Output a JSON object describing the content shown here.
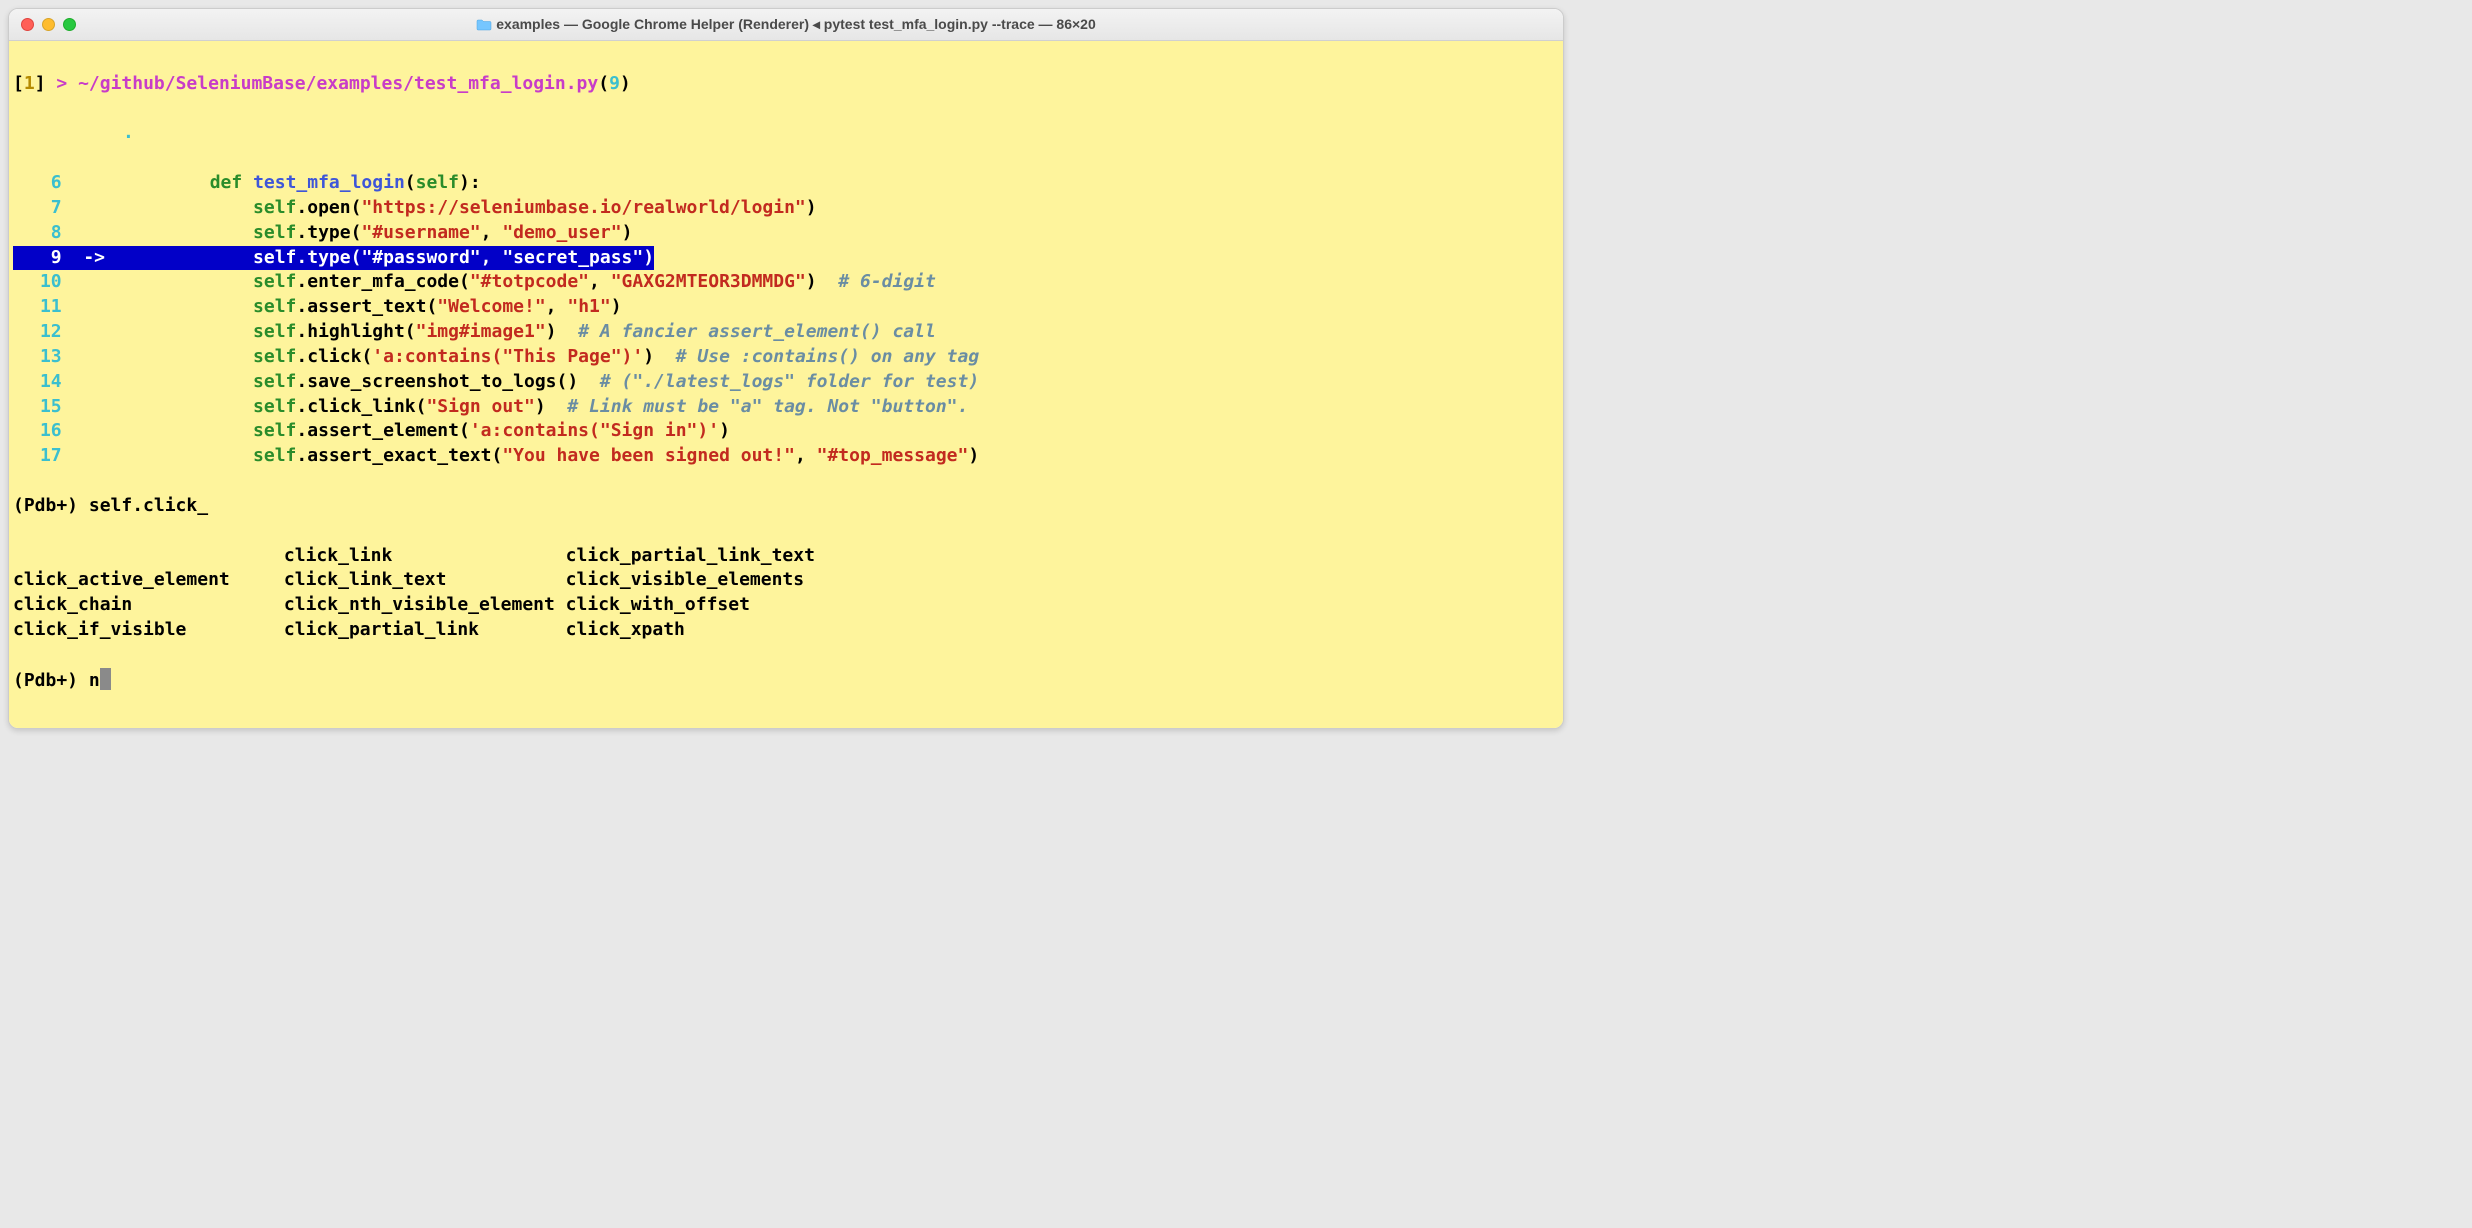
{
  "window": {
    "title": "examples — Google Chrome Helper (Renderer) ◂ pytest test_mfa_login.py --trace — 86×20"
  },
  "header": {
    "bracket_open": "[",
    "num": "1",
    "bracket_close": "] ",
    "gt": ">",
    "sp": " ",
    "path": "~/github/SeleniumBase/examples/test_mfa_login.py",
    "paren_open": "(",
    "cur_line": "9",
    "paren_close": ")"
  },
  "ellipsis": ".",
  "lines": [
    {
      "n": "6",
      "indent": "        ",
      "pre": "def ",
      "fn": "test_mfa_login",
      "sig_open": "(",
      "self": "self",
      "sig_close": "):",
      "arrow": "",
      "hl": false
    },
    {
      "n": "7",
      "indent": "            ",
      "self": "self",
      "dot": ".",
      "method": "open",
      "args_open": "(",
      "str": "\"https://seleniumbase.io/realworld/login\"",
      "args_close": ")",
      "arrow": "",
      "hl": false
    },
    {
      "n": "8",
      "indent": "            ",
      "self": "self",
      "dot": ".",
      "method": "type",
      "args_open": "(",
      "str": "\"#username\"",
      "sep": ", ",
      "str2": "\"demo_user\"",
      "args_close": ")",
      "arrow": "",
      "hl": false
    },
    {
      "n": "9",
      "indent": "            ",
      "self": "self",
      "dot": ".",
      "method": "type",
      "args_open": "(",
      "str": "\"#password\"",
      "sep": ", ",
      "str2": "\"secret_pass\"",
      "args_close": ")",
      "arrow": "->",
      "hl": true
    },
    {
      "n": "10",
      "indent": "            ",
      "self": "self",
      "dot": ".",
      "method": "enter_mfa_code",
      "args_open": "(",
      "str": "\"#totpcode\"",
      "sep": ", ",
      "str2": "\"GAXG2MTEOR3DMMDG\"",
      "args_close": ")",
      "cmt": "  # 6-digit",
      "arrow": "",
      "hl": false
    },
    {
      "n": "11",
      "indent": "            ",
      "self": "self",
      "dot": ".",
      "method": "assert_text",
      "args_open": "(",
      "str": "\"Welcome!\"",
      "sep": ", ",
      "str2": "\"h1\"",
      "args_close": ")",
      "arrow": "",
      "hl": false
    },
    {
      "n": "12",
      "indent": "            ",
      "self": "self",
      "dot": ".",
      "method": "highlight",
      "args_open": "(",
      "str": "\"img#image1\"",
      "args_close": ")",
      "cmt": "  # A fancier assert_element() call",
      "arrow": "",
      "hl": false
    },
    {
      "n": "13",
      "indent": "            ",
      "self": "self",
      "dot": ".",
      "method": "click",
      "args_open": "(",
      "str": "'a:contains(\"This Page\")'",
      "args_close": ")",
      "cmt": "  # Use :contains() on any tag",
      "arrow": "",
      "hl": false
    },
    {
      "n": "14",
      "indent": "            ",
      "self": "self",
      "dot": ".",
      "method": "save_screenshot_to_logs",
      "args_open": "(",
      "args_close": ")",
      "cmt": "  # (\"./latest_logs\" folder for test)",
      "arrow": "",
      "hl": false
    },
    {
      "n": "15",
      "indent": "            ",
      "self": "self",
      "dot": ".",
      "method": "click_link",
      "args_open": "(",
      "str": "\"Sign out\"",
      "args_close": ")",
      "cmt": "  # Link must be \"a\" tag. Not \"button\".",
      "arrow": "",
      "hl": false
    },
    {
      "n": "16",
      "indent": "            ",
      "self": "self",
      "dot": ".",
      "method": "assert_element",
      "args_open": "(",
      "str": "'a:contains(\"Sign in\")'",
      "args_close": ")",
      "arrow": "",
      "hl": false
    },
    {
      "n": "17",
      "indent": "            ",
      "self": "self",
      "dot": ".",
      "method": "assert_exact_text",
      "args_open": "(",
      "str": "\"You have been signed out!\"",
      "sep": ", ",
      "str2": "\"#top_message\"",
      "args_close": ")",
      "arrow": "",
      "hl": false
    }
  ],
  "prompt1": {
    "prefix": "(Pdb+) ",
    "input": "self.click_"
  },
  "completions": {
    "col1": [
      "",
      "click_active_element",
      "click_chain",
      "click_if_visible"
    ],
    "col2": [
      "click_link",
      "click_link_text",
      "click_nth_visible_element",
      "click_partial_link"
    ],
    "col3": [
      "click_partial_link_text",
      "click_visible_elements",
      "click_with_offset",
      "click_xpath"
    ]
  },
  "prompt2": {
    "prefix": "(Pdb+) ",
    "input": "n"
  }
}
